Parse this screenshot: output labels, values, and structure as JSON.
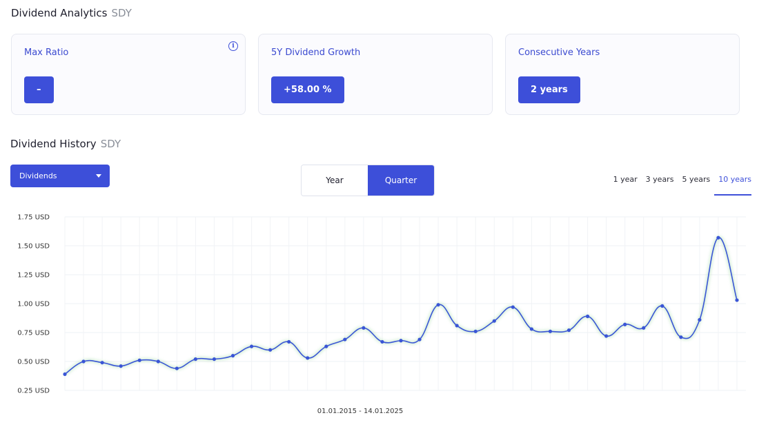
{
  "analytics": {
    "title": "Dividend Analytics",
    "ticker": "SDY"
  },
  "cards": [
    {
      "title": "Max Ratio",
      "value": "–",
      "has_info": true
    },
    {
      "title": "5Y Dividend Growth",
      "value": "+58.00 %"
    },
    {
      "title": "Consecutive Years",
      "value": "2 years"
    }
  ],
  "history": {
    "title": "Dividend History",
    "ticker": "SDY"
  },
  "dropdown": {
    "selected": "Dividends"
  },
  "toggle": {
    "options": [
      "Year",
      "Quarter"
    ],
    "active": "Quarter"
  },
  "ranges": {
    "options": [
      "1 year",
      "3 years",
      "5 years",
      "10 years"
    ],
    "active": "10 years"
  },
  "colors": {
    "accent": "#3d4fd9",
    "line": "#3a55d6"
  },
  "icons": {
    "info": "info-icon",
    "dropdown": "caret-down-icon"
  },
  "chart_data": {
    "type": "line",
    "xlabel": "01.01.2015 - 14.01.2025",
    "ylabel": "",
    "ylim": [
      0.25,
      1.75
    ],
    "yticks": [
      0.25,
      0.5,
      0.75,
      1.0,
      1.25,
      1.5,
      1.75
    ],
    "ytick_labels": [
      "0.25 USD",
      "0.50 USD",
      "0.75 USD",
      "1.00 USD",
      "1.25 USD",
      "1.50 USD",
      "1.75 USD"
    ],
    "grid": true,
    "smooth": true,
    "series": [
      {
        "values": [
          0.39,
          0.5,
          0.49,
          0.46,
          0.51,
          0.5,
          0.44,
          0.52,
          0.52,
          0.55,
          0.63,
          0.6,
          0.67,
          0.53,
          0.63,
          0.69,
          0.79,
          0.67,
          0.68,
          0.69,
          0.99,
          0.81,
          0.76,
          0.85,
          0.97,
          0.78,
          0.76,
          0.77,
          0.89,
          0.72,
          0.82,
          0.79,
          0.98,
          0.71,
          0.86,
          1.57,
          1.03
        ]
      }
    ]
  }
}
